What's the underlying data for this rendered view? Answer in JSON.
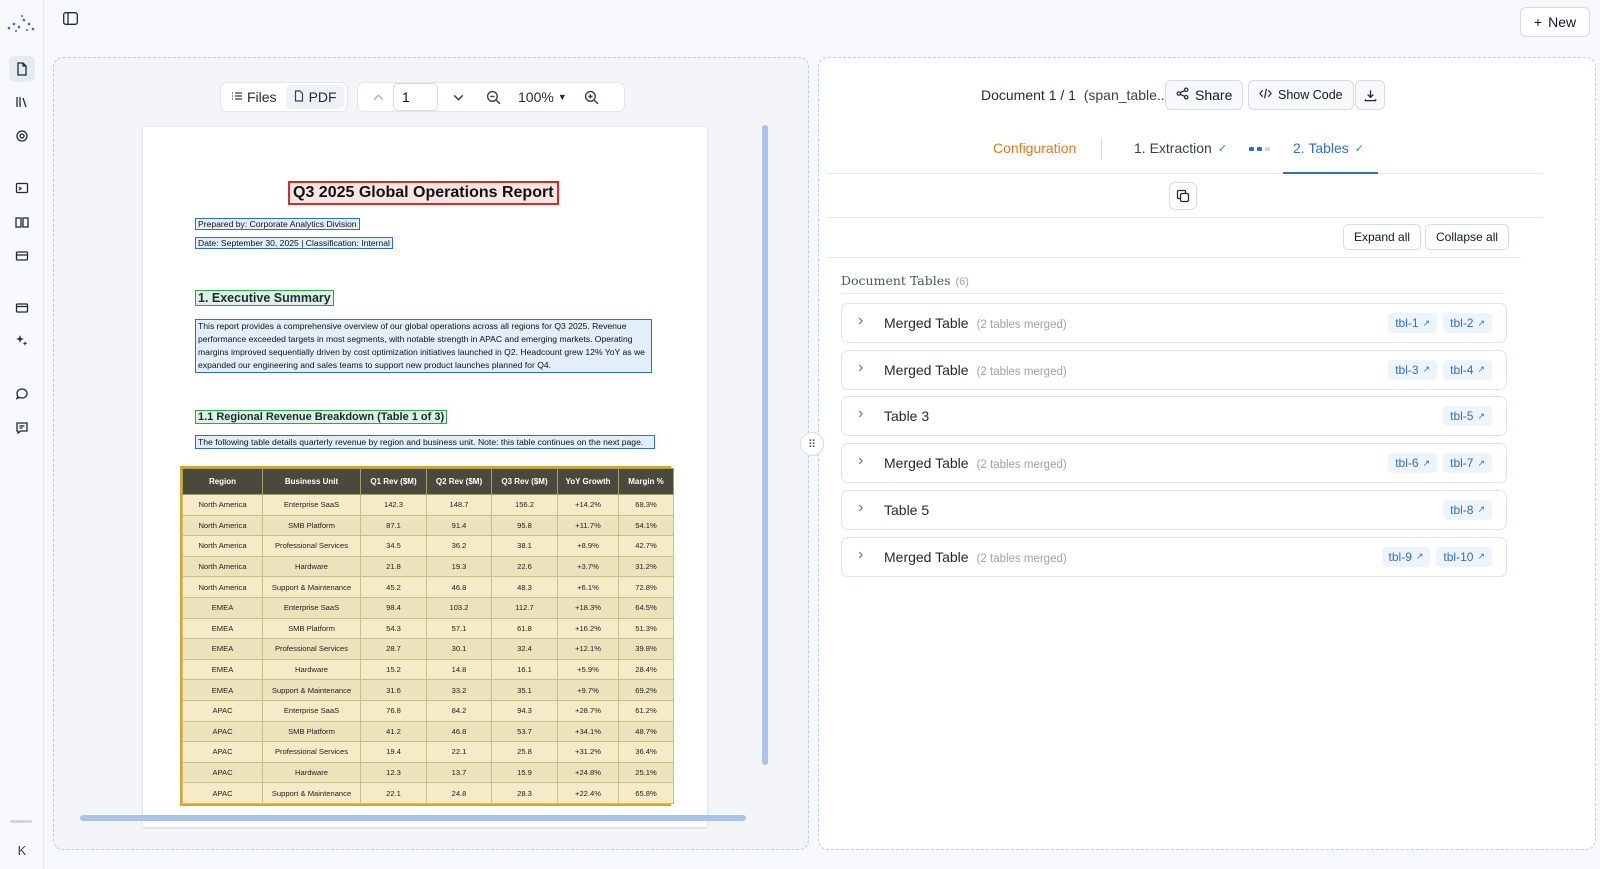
{
  "rail": {
    "icons": [
      "document-icon",
      "library-icon",
      "settings-icon",
      "terminal-icon",
      "book-icon",
      "card-icon",
      "billing-icon",
      "sparkle-icon",
      "chat-icon",
      "feedback-icon"
    ],
    "user_initial": "K"
  },
  "header": {
    "new_label": "New"
  },
  "viewer": {
    "files_label": "Files",
    "pdf_label": "PDF",
    "page_value": "1",
    "zoom": "100%"
  },
  "pdf": {
    "title": "Q3 2025 Global Operations Report",
    "prepared_by": "Prepared by: Corporate Analytics Division",
    "date_line": "Date: September 30, 2025 | Classification: Internal",
    "section1": "1. Executive Summary",
    "summary": "This report provides a comprehensive overview of our global operations across all regions for Q3 2025. Revenue performance exceeded targets in most segments, with notable strength in APAC and emerging markets. Operating margins improved sequentially driven by cost optimization initiatives launched in Q2. Headcount grew 12% YoY as we expanded our engineering and sales teams to support new product launches planned for Q4.",
    "section1_1": "1.1 Regional Revenue Breakdown (Table 1 of 3)",
    "table_note": "The following table details quarterly revenue by region and business unit. Note: this table continues on the next page.",
    "table": {
      "headers": [
        "Region",
        "Business Unit",
        "Q1 Rev ($M)",
        "Q2 Rev ($M)",
        "Q3 Rev ($M)",
        "YoY Growth",
        "Margin %"
      ],
      "rows": [
        [
          "North America",
          "Enterprise SaaS",
          "142.3",
          "148.7",
          "156.2",
          "+14.2%",
          "68.3%"
        ],
        [
          "North America",
          "SMB Platform",
          "87.1",
          "91.4",
          "95.8",
          "+11.7%",
          "54.1%"
        ],
        [
          "North America",
          "Professional Services",
          "34.5",
          "36.2",
          "38.1",
          "+8.9%",
          "42.7%"
        ],
        [
          "North America",
          "Hardware",
          "21.8",
          "19.3",
          "22.6",
          "+3.7%",
          "31.2%"
        ],
        [
          "North America",
          "Support & Maintenance",
          "45.2",
          "46.8",
          "48.3",
          "+6.1%",
          "72.8%"
        ],
        [
          "EMEA",
          "Enterprise SaaS",
          "98.4",
          "103.2",
          "112.7",
          "+18.3%",
          "64.5%"
        ],
        [
          "EMEA",
          "SMB Platform",
          "54.3",
          "57.1",
          "61.8",
          "+16.2%",
          "51.3%"
        ],
        [
          "EMEA",
          "Professional Services",
          "28.7",
          "30.1",
          "32.4",
          "+12.1%",
          "39.8%"
        ],
        [
          "EMEA",
          "Hardware",
          "15.2",
          "14.8",
          "16.1",
          "+5.9%",
          "28.4%"
        ],
        [
          "EMEA",
          "Support & Maintenance",
          "31.6",
          "33.2",
          "35.1",
          "+9.7%",
          "69.2%"
        ],
        [
          "APAC",
          "Enterprise SaaS",
          "76.8",
          "84.2",
          "94.3",
          "+28.7%",
          "61.2%"
        ],
        [
          "APAC",
          "SMB Platform",
          "41.2",
          "46.8",
          "53.7",
          "+34.1%",
          "48.7%"
        ],
        [
          "APAC",
          "Professional Services",
          "19.4",
          "22.1",
          "25.8",
          "+31.2%",
          "36.4%"
        ],
        [
          "APAC",
          "Hardware",
          "12.3",
          "13.7",
          "15.9",
          "+24.8%",
          "25.1%"
        ],
        [
          "APAC",
          "Support & Maintenance",
          "22.1",
          "24.8",
          "28.3",
          "+22.4%",
          "65.8%"
        ]
      ]
    }
  },
  "results": {
    "doc_position": "Document 1 / 1",
    "file_name": "(span_table...)",
    "share_label": "Share",
    "show_code_label": "Show Code",
    "tabs": {
      "configuration": "Configuration",
      "extraction": "1. Extraction",
      "tables": "2. Tables"
    },
    "expand_all": "Expand all",
    "collapse_all": "Collapse all",
    "section_title": "Document Tables",
    "section_count": "(6)",
    "tables": [
      {
        "name": "Merged Table",
        "merged": "(2 tables merged)",
        "badges": [
          "tbl-1",
          "tbl-2"
        ]
      },
      {
        "name": "Merged Table",
        "merged": "(2 tables merged)",
        "badges": [
          "tbl-3",
          "tbl-4"
        ]
      },
      {
        "name": "Table 3",
        "merged": "",
        "badges": [
          "tbl-5"
        ]
      },
      {
        "name": "Merged Table",
        "merged": "(2 tables merged)",
        "badges": [
          "tbl-6",
          "tbl-7"
        ]
      },
      {
        "name": "Table 5",
        "merged": "",
        "badges": [
          "tbl-8"
        ]
      },
      {
        "name": "Merged Table",
        "merged": "(2 tables merged)",
        "badges": [
          "tbl-9",
          "tbl-10"
        ]
      }
    ]
  },
  "colors": {
    "accent_blue": "#2f6fc4",
    "config_orange": "#e07a1b",
    "title_box_red": "#d12b2b",
    "heading_box_green": "#2ea44f",
    "table_box_yellow": "#e3a514"
  }
}
